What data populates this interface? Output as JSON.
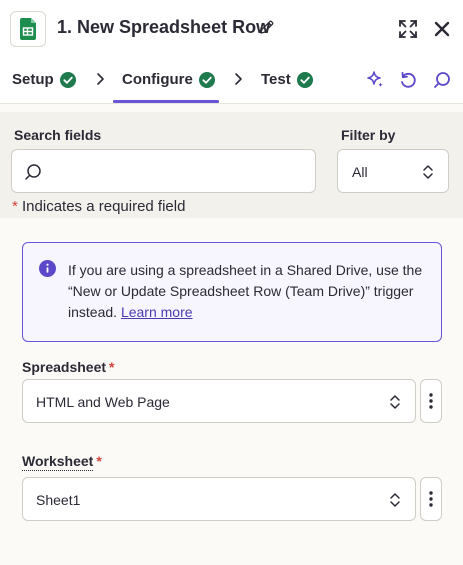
{
  "header": {
    "app_icon": "google-sheets-icon",
    "title": "1. New Spreadsheet Row",
    "edit_icon": "pencil-icon",
    "expand_icon": "expand-icon",
    "close_icon": "close-icon"
  },
  "tabs": [
    {
      "label": "Setup",
      "status": "complete",
      "active": false
    },
    {
      "label": "Configure",
      "status": "complete",
      "active": true
    },
    {
      "label": "Test",
      "status": "complete",
      "active": false
    }
  ],
  "toolbar": {
    "icons": [
      "sparkle-icon",
      "undo-icon",
      "search-icon"
    ]
  },
  "search": {
    "label": "Search fields",
    "value": "",
    "placeholder": ""
  },
  "filter": {
    "label": "Filter by",
    "value": "All"
  },
  "required_note": {
    "star": "*",
    "text": "Indicates a required field"
  },
  "info": {
    "text": "If you are using a spreadsheet in a Shared Drive, use the “New or Update Spreadsheet Row (Team Drive)” trigger instead.",
    "link": "Learn more"
  },
  "fields": [
    {
      "label": "Spreadsheet",
      "required": "*",
      "value": "HTML and Web Page"
    },
    {
      "label": "Worksheet",
      "required": "*",
      "value": "Sheet1"
    }
  ],
  "colors": {
    "accent": "#6a55d8",
    "success": "#1f7a4d",
    "required": "#d2423b",
    "sheets_green": "#1e8e4e"
  }
}
